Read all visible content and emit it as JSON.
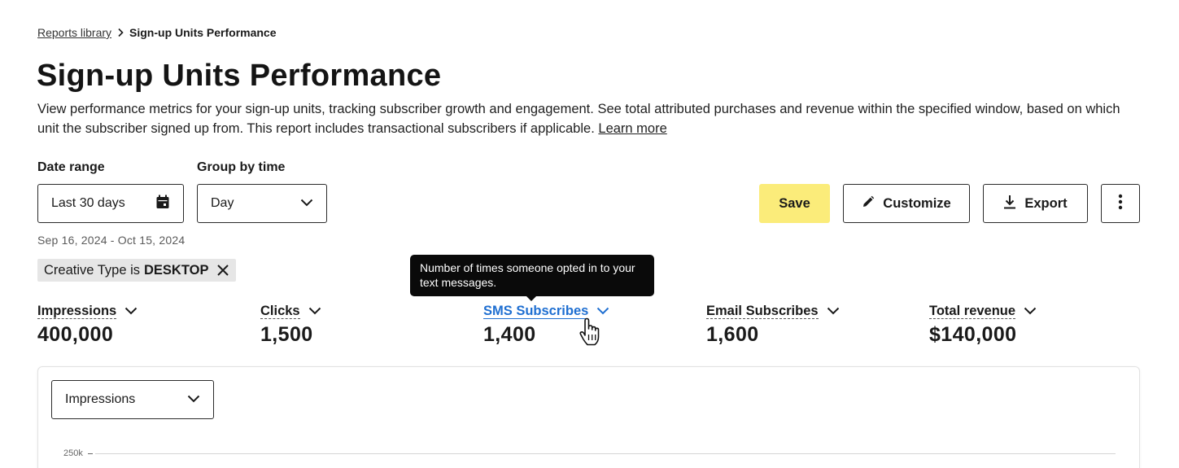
{
  "breadcrumb": {
    "parent": "Reports library",
    "current": "Sign-up Units Performance"
  },
  "page": {
    "title": "Sign-up Units Performance",
    "description": "View performance metrics for your sign-up units, tracking subscriber growth and engagement. See total attributed purchases and revenue within the specified window, based on which unit the subscriber signed up from. This report includes transactional subscribers if applicable.",
    "learn_more": "Learn more"
  },
  "controls": {
    "date_range_label": "Date range",
    "date_range_value": "Last 30 days",
    "group_by_label": "Group by time",
    "group_by_value": "Day",
    "date_caption": "Sep 16, 2024 - Oct 15, 2024"
  },
  "actions": {
    "save": "Save",
    "customize": "Customize",
    "export": "Export"
  },
  "filter": {
    "prefix": "Creative Type is",
    "value": "DESKTOP"
  },
  "tooltip": {
    "text": "Number of times someone opted in to your text messages."
  },
  "metrics": [
    {
      "name": "Impressions",
      "value": "400,000"
    },
    {
      "name": "Clicks",
      "value": "1,500"
    },
    {
      "name": "SMS Subscribes",
      "value": "1,400"
    },
    {
      "name": "Email Subscribes",
      "value": "1,600"
    },
    {
      "name": "Total revenue",
      "value": "$140,000"
    }
  ],
  "chart": {
    "metric_select": "Impressions",
    "y_tick": "250k"
  },
  "colors": {
    "save_bg": "#fbec7a",
    "link_active": "#1f6fd1",
    "tooltip_bg": "#0a0a0a"
  }
}
